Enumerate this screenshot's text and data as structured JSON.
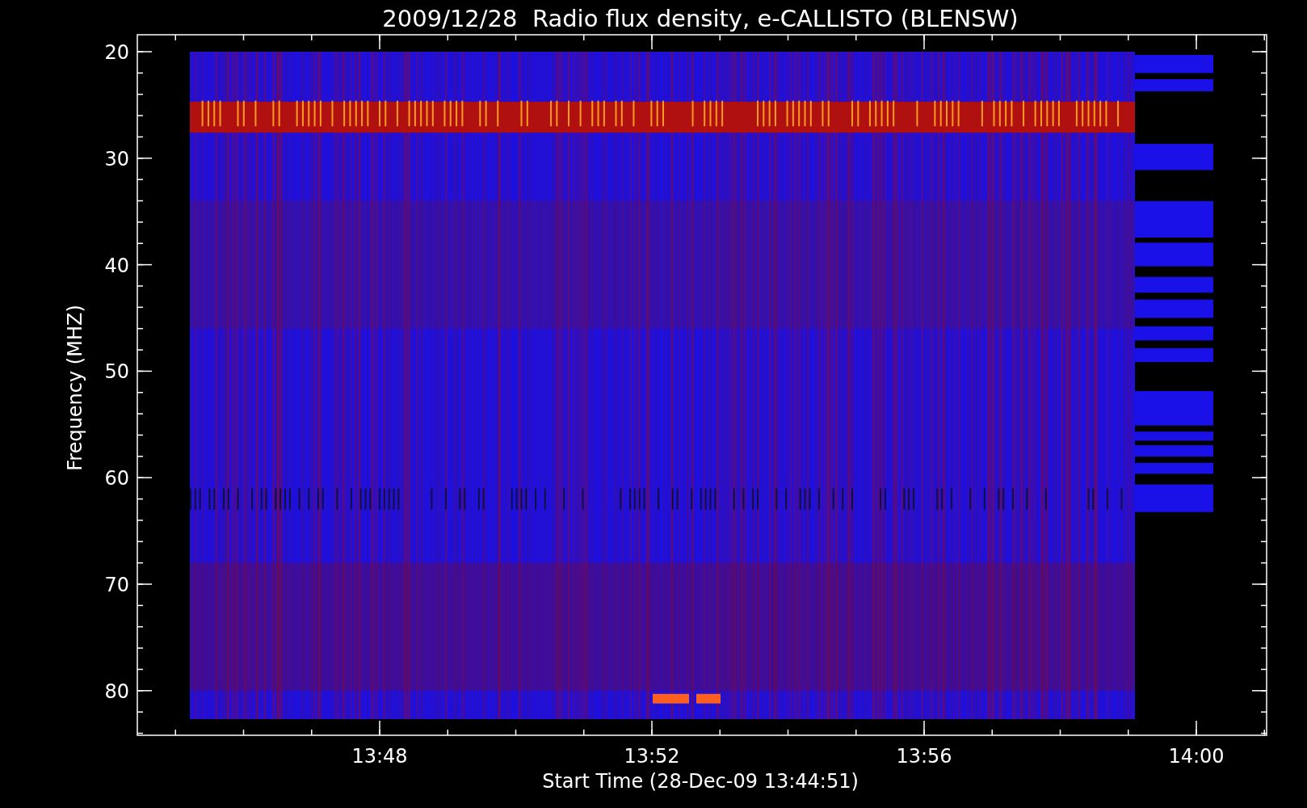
{
  "title": "2009/12/28  Radio flux density, e-CALLISTO (BLENSW)",
  "y_axis": {
    "label": "Frequency (MHZ)",
    "ticks": [
      "20",
      "30",
      "40",
      "50",
      "60",
      "70",
      "80"
    ]
  },
  "x_axis": {
    "label": "Start Time (28-Dec-09 13:44:51)",
    "ticks": [
      "13:48",
      "13:52",
      "13:56",
      "14:00"
    ]
  }
}
